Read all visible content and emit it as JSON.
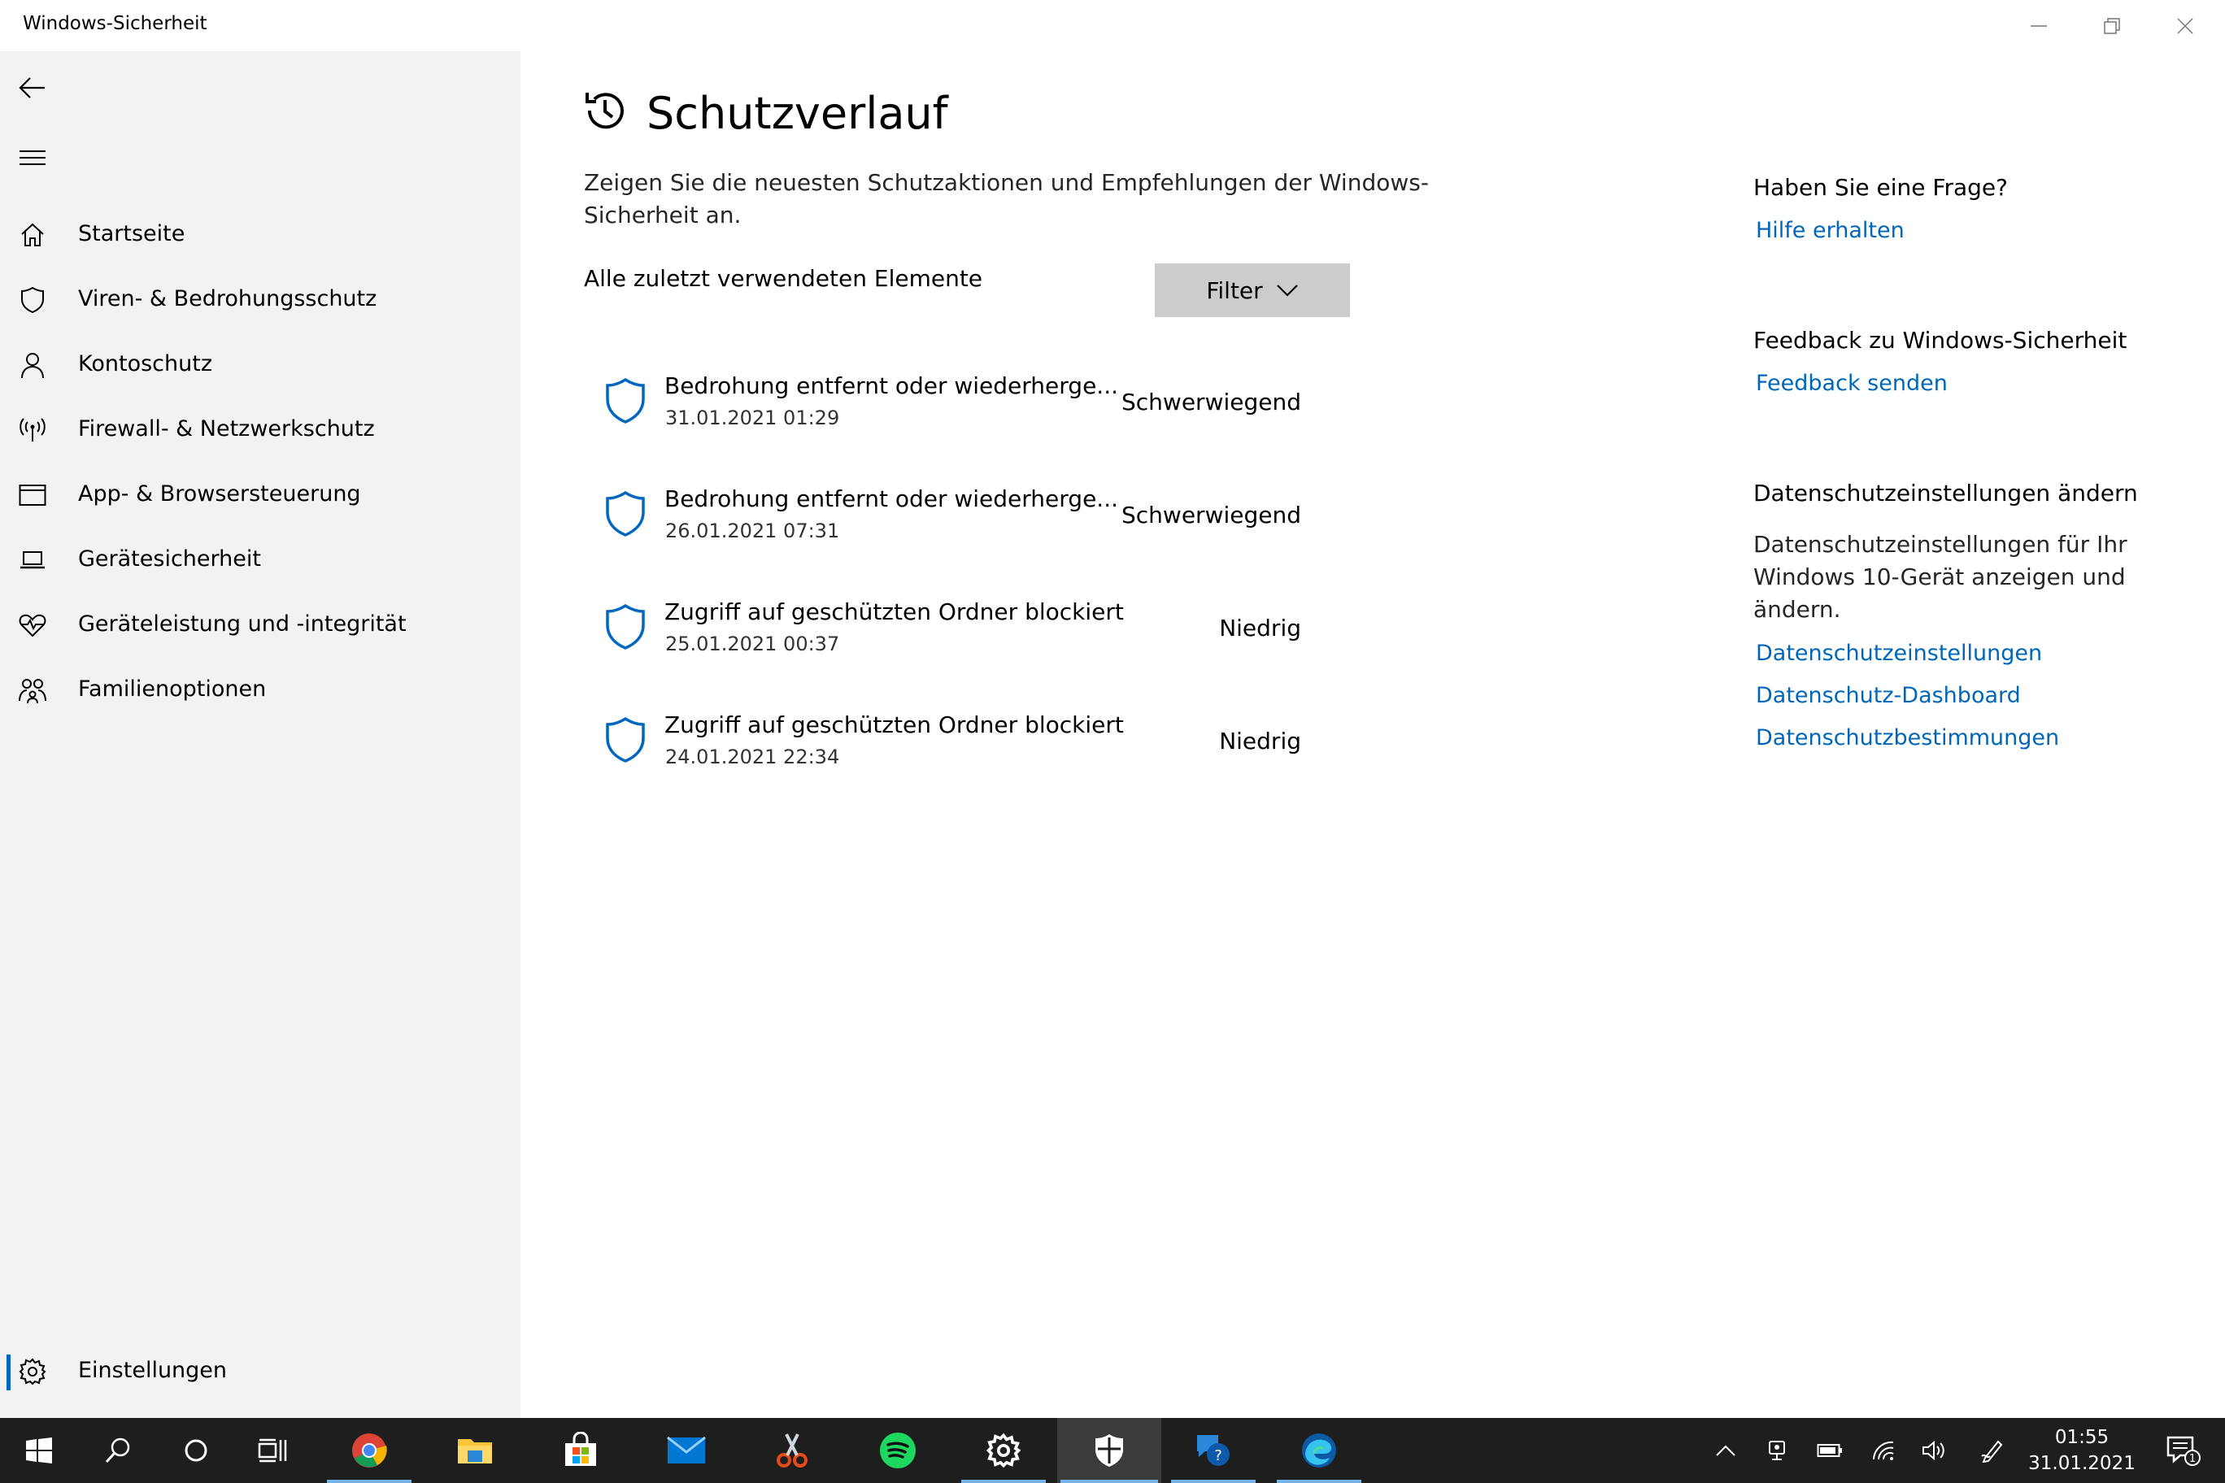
{
  "window": {
    "title": "Windows-Sicherheit"
  },
  "sidebar": {
    "items": [
      {
        "label": "Startseite",
        "icon": "home-icon"
      },
      {
        "label": "Viren- & Bedrohungsschutz",
        "icon": "shield-icon"
      },
      {
        "label": "Kontoschutz",
        "icon": "person-icon"
      },
      {
        "label": "Firewall- & Netzwerkschutz",
        "icon": "antenna-icon"
      },
      {
        "label": "App- & Browsersteuerung",
        "icon": "browser-window-icon"
      },
      {
        "label": "Gerätesicherheit",
        "icon": "laptop-icon"
      },
      {
        "label": "Geräteleistung und -integrität",
        "icon": "heart-pulse-icon"
      },
      {
        "label": "Familienoptionen",
        "icon": "family-icon"
      }
    ],
    "settings": {
      "label": "Einstellungen",
      "icon": "gear-icon"
    }
  },
  "main": {
    "title": "Schutzverlauf",
    "description": "Zeigen Sie die neuesten Schutzaktionen und Empfehlungen der Windows-Sicherheit an.",
    "list_header": "Alle zuletzt verwendeten Elemente",
    "filter_label": "Filter",
    "items": [
      {
        "title": "Bedrohung entfernt oder wiederherge...",
        "date": "31.01.2021 01:29",
        "severity": "Schwerwiegend"
      },
      {
        "title": "Bedrohung entfernt oder wiederherge...",
        "date": "26.01.2021 07:31",
        "severity": "Schwerwiegend"
      },
      {
        "title": "Zugriff auf geschützten Ordner blockiert",
        "date": "25.01.2021 00:37",
        "severity": "Niedrig"
      },
      {
        "title": "Zugriff auf geschützten Ordner blockiert",
        "date": "24.01.2021 22:34",
        "severity": "Niedrig"
      }
    ]
  },
  "right": {
    "question_heading": "Haben Sie eine Frage?",
    "help_link": "Hilfe erhalten",
    "feedback_heading": "Feedback zu Windows-Sicherheit",
    "feedback_link": "Feedback senden",
    "privacy_heading": "Datenschutzeinstellungen ändern",
    "privacy_text": "Datenschutzeinstellungen für Ihr Windows 10-Gerät anzeigen und ändern.",
    "privacy_links": [
      "Datenschutzeinstellungen",
      "Datenschutz-Dashboard",
      "Datenschutzbestimmungen"
    ]
  },
  "taskbar": {
    "clock_time": "01:55",
    "clock_date": "31.01.2021",
    "notification_count": "1"
  },
  "colors": {
    "accent": "#0067c0",
    "link": "#0067b8",
    "sidebar_bg": "#f2f2f2",
    "taskbar_bg": "#1e1e1e"
  }
}
